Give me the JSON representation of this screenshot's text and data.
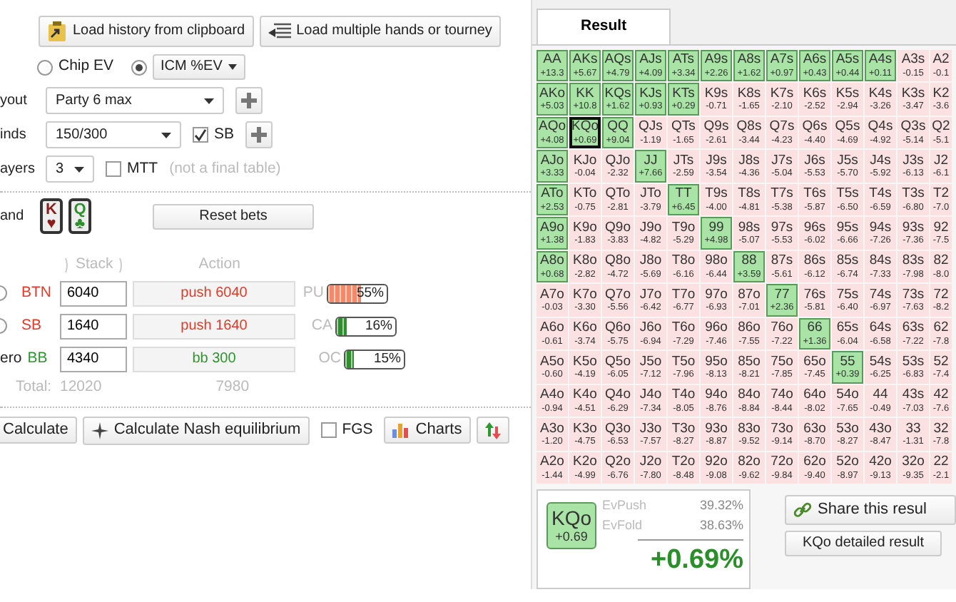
{
  "toolbar": [
    {
      "label": "Load history from clipboard"
    },
    {
      "label": "Load multiple hands or tourney"
    }
  ],
  "ev_modes": [
    {
      "label": "Chip EV",
      "selected": false,
      "dropdown": false
    },
    {
      "label": "ICM %EV",
      "selected": true,
      "dropdown": true
    }
  ],
  "settings": [
    {
      "label": "yout",
      "value": "Party 6 max",
      "plus": true
    },
    {
      "label": "inds",
      "value": "150/300",
      "checkbox": {
        "label": "SB",
        "checked": true
      },
      "plus": true
    },
    {
      "label": "ayers",
      "value": "3",
      "checkbox": {
        "label": "MTT",
        "checked": false
      },
      "note": "(not a final table)",
      "plus": false
    }
  ],
  "hand": {
    "label": "and",
    "cards": [
      {
        "rank": "K",
        "suit": "♥",
        "color": "#8b1d1d"
      },
      {
        "rank": "Q",
        "suit": "♣",
        "color": "#2f8f2f"
      }
    ],
    "reset_button": "Reset bets"
  },
  "players_header": {
    "stack": "Stack",
    "action": "Action"
  },
  "players": [
    {
      "hero": false,
      "selected": false,
      "position": "BTN",
      "stack": "6040",
      "action": "push 6040",
      "pushes": true,
      "tag": "PU",
      "level": 0.55,
      "reading": "55%",
      "color": "#f08a6a"
    },
    {
      "hero": false,
      "selected": false,
      "position": "SB",
      "stack": "1640",
      "action": "push 1640",
      "pushes": true,
      "tag": "CA",
      "level": 0.16,
      "reading": "16%",
      "color": "#2f8f2f"
    },
    {
      "hero": true,
      "hero_label": "ero",
      "position": "BB",
      "stack": "4340",
      "action": "bb 300",
      "pushes": false,
      "tag": "OC",
      "level": 0.15,
      "reading": "15%",
      "color": "#2f8f2f"
    }
  ],
  "totals": {
    "label": "Total:",
    "stack": "12020",
    "action": "7980"
  },
  "actions": {
    "calculate": "Calculate",
    "nash": "Calculate Nash equilibrium",
    "fgs": {
      "label": "FGS",
      "checked": false
    },
    "charts": "Charts"
  },
  "result_tabs": [
    {
      "label": "Result",
      "selected": true
    }
  ],
  "grid": [
    [
      {
        "hand": "AA",
        "ev": "+13.3",
        "push": true,
        "selected": false
      },
      {
        "hand": "AKs",
        "ev": "+5.67",
        "push": true,
        "selected": false
      },
      {
        "hand": "AQs",
        "ev": "+4.79",
        "push": true,
        "selected": false
      },
      {
        "hand": "AJs",
        "ev": "+4.09",
        "push": true,
        "selected": false
      },
      {
        "hand": "ATs",
        "ev": "+3.34",
        "push": true,
        "selected": false
      },
      {
        "hand": "A9s",
        "ev": "+2.26",
        "push": true,
        "selected": false
      },
      {
        "hand": "A8s",
        "ev": "+1.62",
        "push": true,
        "selected": false
      },
      {
        "hand": "A7s",
        "ev": "+0.97",
        "push": true,
        "selected": false
      },
      {
        "hand": "A6s",
        "ev": "+0.43",
        "push": true,
        "selected": false
      },
      {
        "hand": "A5s",
        "ev": "+0.44",
        "push": true,
        "selected": false
      },
      {
        "hand": "A4s",
        "ev": "+0.11",
        "push": true,
        "selected": false
      },
      {
        "hand": "A3s",
        "ev": "-0.15",
        "push": false,
        "selected": false
      },
      {
        "hand": "A2",
        "ev": "-0.1",
        "push": false,
        "selected": false
      }
    ],
    [
      {
        "hand": "AKo",
        "ev": "+5.03",
        "push": true,
        "selected": false
      },
      {
        "hand": "KK",
        "ev": "+10.8",
        "push": true,
        "selected": false
      },
      {
        "hand": "KQs",
        "ev": "+1.62",
        "push": true,
        "selected": false
      },
      {
        "hand": "KJs",
        "ev": "+0.93",
        "push": true,
        "selected": false
      },
      {
        "hand": "KTs",
        "ev": "+0.29",
        "push": true,
        "selected": false
      },
      {
        "hand": "K9s",
        "ev": "-0.71",
        "push": false,
        "selected": false
      },
      {
        "hand": "K8s",
        "ev": "-1.65",
        "push": false,
        "selected": false
      },
      {
        "hand": "K7s",
        "ev": "-2.10",
        "push": false,
        "selected": false
      },
      {
        "hand": "K6s",
        "ev": "-2.52",
        "push": false,
        "selected": false
      },
      {
        "hand": "K5s",
        "ev": "-2.94",
        "push": false,
        "selected": false
      },
      {
        "hand": "K4s",
        "ev": "-3.26",
        "push": false,
        "selected": false
      },
      {
        "hand": "K3s",
        "ev": "-3.47",
        "push": false,
        "selected": false
      },
      {
        "hand": "K2",
        "ev": "-3.6",
        "push": false,
        "selected": false
      }
    ],
    [
      {
        "hand": "AQo",
        "ev": "+4.08",
        "push": true,
        "selected": false
      },
      {
        "hand": "KQo",
        "ev": "+0.69",
        "push": true,
        "selected": true
      },
      {
        "hand": "QQ",
        "ev": "+9.04",
        "push": true,
        "selected": false
      },
      {
        "hand": "QJs",
        "ev": "-1.19",
        "push": false,
        "selected": false
      },
      {
        "hand": "QTs",
        "ev": "-1.65",
        "push": false,
        "selected": false
      },
      {
        "hand": "Q9s",
        "ev": "-2.61",
        "push": false,
        "selected": false
      },
      {
        "hand": "Q8s",
        "ev": "-3.44",
        "push": false,
        "selected": false
      },
      {
        "hand": "Q7s",
        "ev": "-4.23",
        "push": false,
        "selected": false
      },
      {
        "hand": "Q6s",
        "ev": "-4.40",
        "push": false,
        "selected": false
      },
      {
        "hand": "Q5s",
        "ev": "-4.69",
        "push": false,
        "selected": false
      },
      {
        "hand": "Q4s",
        "ev": "-4.92",
        "push": false,
        "selected": false
      },
      {
        "hand": "Q3s",
        "ev": "-5.14",
        "push": false,
        "selected": false
      },
      {
        "hand": "Q2",
        "ev": "-5.1",
        "push": false,
        "selected": false
      }
    ],
    [
      {
        "hand": "AJo",
        "ev": "+3.33",
        "push": true,
        "selected": false
      },
      {
        "hand": "KJo",
        "ev": "-0.04",
        "push": false,
        "selected": false
      },
      {
        "hand": "QJo",
        "ev": "-2.32",
        "push": false,
        "selected": false
      },
      {
        "hand": "JJ",
        "ev": "+7.66",
        "push": true,
        "selected": false
      },
      {
        "hand": "JTs",
        "ev": "-2.59",
        "push": false,
        "selected": false
      },
      {
        "hand": "J9s",
        "ev": "-3.54",
        "push": false,
        "selected": false
      },
      {
        "hand": "J8s",
        "ev": "-4.36",
        "push": false,
        "selected": false
      },
      {
        "hand": "J7s",
        "ev": "-5.04",
        "push": false,
        "selected": false
      },
      {
        "hand": "J6s",
        "ev": "-5.53",
        "push": false,
        "selected": false
      },
      {
        "hand": "J5s",
        "ev": "-5.70",
        "push": false,
        "selected": false
      },
      {
        "hand": "J4s",
        "ev": "-5.92",
        "push": false,
        "selected": false
      },
      {
        "hand": "J3s",
        "ev": "-6.13",
        "push": false,
        "selected": false
      },
      {
        "hand": "J2",
        "ev": "-6.1",
        "push": false,
        "selected": false
      }
    ],
    [
      {
        "hand": "ATo",
        "ev": "+2.53",
        "push": true,
        "selected": false
      },
      {
        "hand": "KTo",
        "ev": "-0.75",
        "push": false,
        "selected": false
      },
      {
        "hand": "QTo",
        "ev": "-2.81",
        "push": false,
        "selected": false
      },
      {
        "hand": "JTo",
        "ev": "-3.79",
        "push": false,
        "selected": false
      },
      {
        "hand": "TT",
        "ev": "+6.45",
        "push": true,
        "selected": false
      },
      {
        "hand": "T9s",
        "ev": "-4.00",
        "push": false,
        "selected": false
      },
      {
        "hand": "T8s",
        "ev": "-4.81",
        "push": false,
        "selected": false
      },
      {
        "hand": "T7s",
        "ev": "-5.38",
        "push": false,
        "selected": false
      },
      {
        "hand": "T6s",
        "ev": "-5.87",
        "push": false,
        "selected": false
      },
      {
        "hand": "T5s",
        "ev": "-6.50",
        "push": false,
        "selected": false
      },
      {
        "hand": "T4s",
        "ev": "-6.59",
        "push": false,
        "selected": false
      },
      {
        "hand": "T3s",
        "ev": "-6.80",
        "push": false,
        "selected": false
      },
      {
        "hand": "T2",
        "ev": "-7.0",
        "push": false,
        "selected": false
      }
    ],
    [
      {
        "hand": "A9o",
        "ev": "+1.38",
        "push": true,
        "selected": false
      },
      {
        "hand": "K9o",
        "ev": "-1.83",
        "push": false,
        "selected": false
      },
      {
        "hand": "Q9o",
        "ev": "-3.83",
        "push": false,
        "selected": false
      },
      {
        "hand": "J9o",
        "ev": "-4.82",
        "push": false,
        "selected": false
      },
      {
        "hand": "T9o",
        "ev": "-5.29",
        "push": false,
        "selected": false
      },
      {
        "hand": "99",
        "ev": "+4.98",
        "push": true,
        "selected": false
      },
      {
        "hand": "98s",
        "ev": "-5.07",
        "push": false,
        "selected": false
      },
      {
        "hand": "97s",
        "ev": "-5.53",
        "push": false,
        "selected": false
      },
      {
        "hand": "96s",
        "ev": "-6.02",
        "push": false,
        "selected": false
      },
      {
        "hand": "95s",
        "ev": "-6.66",
        "push": false,
        "selected": false
      },
      {
        "hand": "94s",
        "ev": "-7.26",
        "push": false,
        "selected": false
      },
      {
        "hand": "93s",
        "ev": "-7.36",
        "push": false,
        "selected": false
      },
      {
        "hand": "92",
        "ev": "-7.5",
        "push": false,
        "selected": false
      }
    ],
    [
      {
        "hand": "A8o",
        "ev": "+0.68",
        "push": true,
        "selected": false
      },
      {
        "hand": "K8o",
        "ev": "-2.82",
        "push": false,
        "selected": false
      },
      {
        "hand": "Q8o",
        "ev": "-4.72",
        "push": false,
        "selected": false
      },
      {
        "hand": "J8o",
        "ev": "-5.69",
        "push": false,
        "selected": false
      },
      {
        "hand": "T8o",
        "ev": "-6.16",
        "push": false,
        "selected": false
      },
      {
        "hand": "98o",
        "ev": "-6.44",
        "push": false,
        "selected": false
      },
      {
        "hand": "88",
        "ev": "+3.59",
        "push": true,
        "selected": false
      },
      {
        "hand": "87s",
        "ev": "-5.61",
        "push": false,
        "selected": false
      },
      {
        "hand": "86s",
        "ev": "-6.12",
        "push": false,
        "selected": false
      },
      {
        "hand": "85s",
        "ev": "-6.74",
        "push": false,
        "selected": false
      },
      {
        "hand": "84s",
        "ev": "-7.33",
        "push": false,
        "selected": false
      },
      {
        "hand": "83s",
        "ev": "-7.98",
        "push": false,
        "selected": false
      },
      {
        "hand": "82",
        "ev": "-8.0",
        "push": false,
        "selected": false
      }
    ],
    [
      {
        "hand": "A7o",
        "ev": "-0.03",
        "push": false,
        "selected": false
      },
      {
        "hand": "K7o",
        "ev": "-3.30",
        "push": false,
        "selected": false
      },
      {
        "hand": "Q7o",
        "ev": "-5.56",
        "push": false,
        "selected": false
      },
      {
        "hand": "J7o",
        "ev": "-6.42",
        "push": false,
        "selected": false
      },
      {
        "hand": "T7o",
        "ev": "-6.77",
        "push": false,
        "selected": false
      },
      {
        "hand": "97o",
        "ev": "-6.93",
        "push": false,
        "selected": false
      },
      {
        "hand": "87o",
        "ev": "-7.01",
        "push": false,
        "selected": false
      },
      {
        "hand": "77",
        "ev": "+2.36",
        "push": true,
        "selected": false
      },
      {
        "hand": "76s",
        "ev": "-5.81",
        "push": false,
        "selected": false
      },
      {
        "hand": "75s",
        "ev": "-6.40",
        "push": false,
        "selected": false
      },
      {
        "hand": "74s",
        "ev": "-6.97",
        "push": false,
        "selected": false
      },
      {
        "hand": "73s",
        "ev": "-7.63",
        "push": false,
        "selected": false
      },
      {
        "hand": "72",
        "ev": "-8.2",
        "push": false,
        "selected": false
      }
    ],
    [
      {
        "hand": "A6o",
        "ev": "-0.61",
        "push": false,
        "selected": false
      },
      {
        "hand": "K6o",
        "ev": "-3.74",
        "push": false,
        "selected": false
      },
      {
        "hand": "Q6o",
        "ev": "-5.75",
        "push": false,
        "selected": false
      },
      {
        "hand": "J6o",
        "ev": "-6.94",
        "push": false,
        "selected": false
      },
      {
        "hand": "T6o",
        "ev": "-7.29",
        "push": false,
        "selected": false
      },
      {
        "hand": "96o",
        "ev": "-7.46",
        "push": false,
        "selected": false
      },
      {
        "hand": "86o",
        "ev": "-7.55",
        "push": false,
        "selected": false
      },
      {
        "hand": "76o",
        "ev": "-7.22",
        "push": false,
        "selected": false
      },
      {
        "hand": "66",
        "ev": "+1.36",
        "push": true,
        "selected": false
      },
      {
        "hand": "65s",
        "ev": "-6.04",
        "push": false,
        "selected": false
      },
      {
        "hand": "64s",
        "ev": "-6.58",
        "push": false,
        "selected": false
      },
      {
        "hand": "63s",
        "ev": "-7.22",
        "push": false,
        "selected": false
      },
      {
        "hand": "62",
        "ev": "-7.8",
        "push": false,
        "selected": false
      }
    ],
    [
      {
        "hand": "A5o",
        "ev": "-0.60",
        "push": false,
        "selected": false
      },
      {
        "hand": "K5o",
        "ev": "-4.19",
        "push": false,
        "selected": false
      },
      {
        "hand": "Q5o",
        "ev": "-6.05",
        "push": false,
        "selected": false
      },
      {
        "hand": "J5o",
        "ev": "-7.12",
        "push": false,
        "selected": false
      },
      {
        "hand": "T5o",
        "ev": "-7.96",
        "push": false,
        "selected": false
      },
      {
        "hand": "95o",
        "ev": "-8.13",
        "push": false,
        "selected": false
      },
      {
        "hand": "85o",
        "ev": "-8.21",
        "push": false,
        "selected": false
      },
      {
        "hand": "75o",
        "ev": "-7.85",
        "push": false,
        "selected": false
      },
      {
        "hand": "65o",
        "ev": "-7.45",
        "push": false,
        "selected": false
      },
      {
        "hand": "55",
        "ev": "+0.39",
        "push": true,
        "selected": false
      },
      {
        "hand": "54s",
        "ev": "-6.25",
        "push": false,
        "selected": false
      },
      {
        "hand": "53s",
        "ev": "-6.83",
        "push": false,
        "selected": false
      },
      {
        "hand": "52",
        "ev": "-7.4",
        "push": false,
        "selected": false
      }
    ],
    [
      {
        "hand": "A4o",
        "ev": "-0.94",
        "push": false,
        "selected": false
      },
      {
        "hand": "K4o",
        "ev": "-4.51",
        "push": false,
        "selected": false
      },
      {
        "hand": "Q4o",
        "ev": "-6.29",
        "push": false,
        "selected": false
      },
      {
        "hand": "J4o",
        "ev": "-7.34",
        "push": false,
        "selected": false
      },
      {
        "hand": "T4o",
        "ev": "-8.05",
        "push": false,
        "selected": false
      },
      {
        "hand": "94o",
        "ev": "-8.76",
        "push": false,
        "selected": false
      },
      {
        "hand": "84o",
        "ev": "-8.84",
        "push": false,
        "selected": false
      },
      {
        "hand": "74o",
        "ev": "-8.44",
        "push": false,
        "selected": false
      },
      {
        "hand": "64o",
        "ev": "-8.02",
        "push": false,
        "selected": false
      },
      {
        "hand": "54o",
        "ev": "-7.65",
        "push": false,
        "selected": false
      },
      {
        "hand": "44",
        "ev": "-0.49",
        "push": false,
        "selected": false
      },
      {
        "hand": "43s",
        "ev": "-7.03",
        "push": false,
        "selected": false
      },
      {
        "hand": "42",
        "ev": "-7.6",
        "push": false,
        "selected": false
      }
    ],
    [
      {
        "hand": "A3o",
        "ev": "-1.20",
        "push": false,
        "selected": false
      },
      {
        "hand": "K3o",
        "ev": "-4.75",
        "push": false,
        "selected": false
      },
      {
        "hand": "Q3o",
        "ev": "-6.53",
        "push": false,
        "selected": false
      },
      {
        "hand": "J3o",
        "ev": "-7.57",
        "push": false,
        "selected": false
      },
      {
        "hand": "T3o",
        "ev": "-8.27",
        "push": false,
        "selected": false
      },
      {
        "hand": "93o",
        "ev": "-8.87",
        "push": false,
        "selected": false
      },
      {
        "hand": "83o",
        "ev": "-9.52",
        "push": false,
        "selected": false
      },
      {
        "hand": "73o",
        "ev": "-9.14",
        "push": false,
        "selected": false
      },
      {
        "hand": "63o",
        "ev": "-8.70",
        "push": false,
        "selected": false
      },
      {
        "hand": "53o",
        "ev": "-8.27",
        "push": false,
        "selected": false
      },
      {
        "hand": "43o",
        "ev": "-8.47",
        "push": false,
        "selected": false
      },
      {
        "hand": "33",
        "ev": "-1.31",
        "push": false,
        "selected": false
      },
      {
        "hand": "32",
        "ev": "-7.8",
        "push": false,
        "selected": false
      }
    ],
    [
      {
        "hand": "A2o",
        "ev": "-1.44",
        "push": false,
        "selected": false
      },
      {
        "hand": "K2o",
        "ev": "-4.99",
        "push": false,
        "selected": false
      },
      {
        "hand": "Q2o",
        "ev": "-6.76",
        "push": false,
        "selected": false
      },
      {
        "hand": "J2o",
        "ev": "-7.80",
        "push": false,
        "selected": false
      },
      {
        "hand": "T2o",
        "ev": "-8.48",
        "push": false,
        "selected": false
      },
      {
        "hand": "92o",
        "ev": "-9.08",
        "push": false,
        "selected": false
      },
      {
        "hand": "82o",
        "ev": "-9.62",
        "push": false,
        "selected": false
      },
      {
        "hand": "72o",
        "ev": "-9.84",
        "push": false,
        "selected": false
      },
      {
        "hand": "62o",
        "ev": "-9.40",
        "push": false,
        "selected": false
      },
      {
        "hand": "52o",
        "ev": "-8.97",
        "push": false,
        "selected": false
      },
      {
        "hand": "42o",
        "ev": "-9.13",
        "push": false,
        "selected": false
      },
      {
        "hand": "32o",
        "ev": "-9.35",
        "push": false,
        "selected": false
      },
      {
        "hand": "22",
        "ev": "-2.1",
        "push": false,
        "selected": false
      }
    ]
  ],
  "summary": {
    "hand": "KQo",
    "ev": "+0.69",
    "push": true,
    "ev_push_label": "EvPush",
    "ev_push": "39.32%",
    "ev_fold_label": "EvFold",
    "ev_fold": "38.63%",
    "result": "+0.69%"
  },
  "share_button": "Share this resul",
  "detail_button": "KQo detailed result"
}
